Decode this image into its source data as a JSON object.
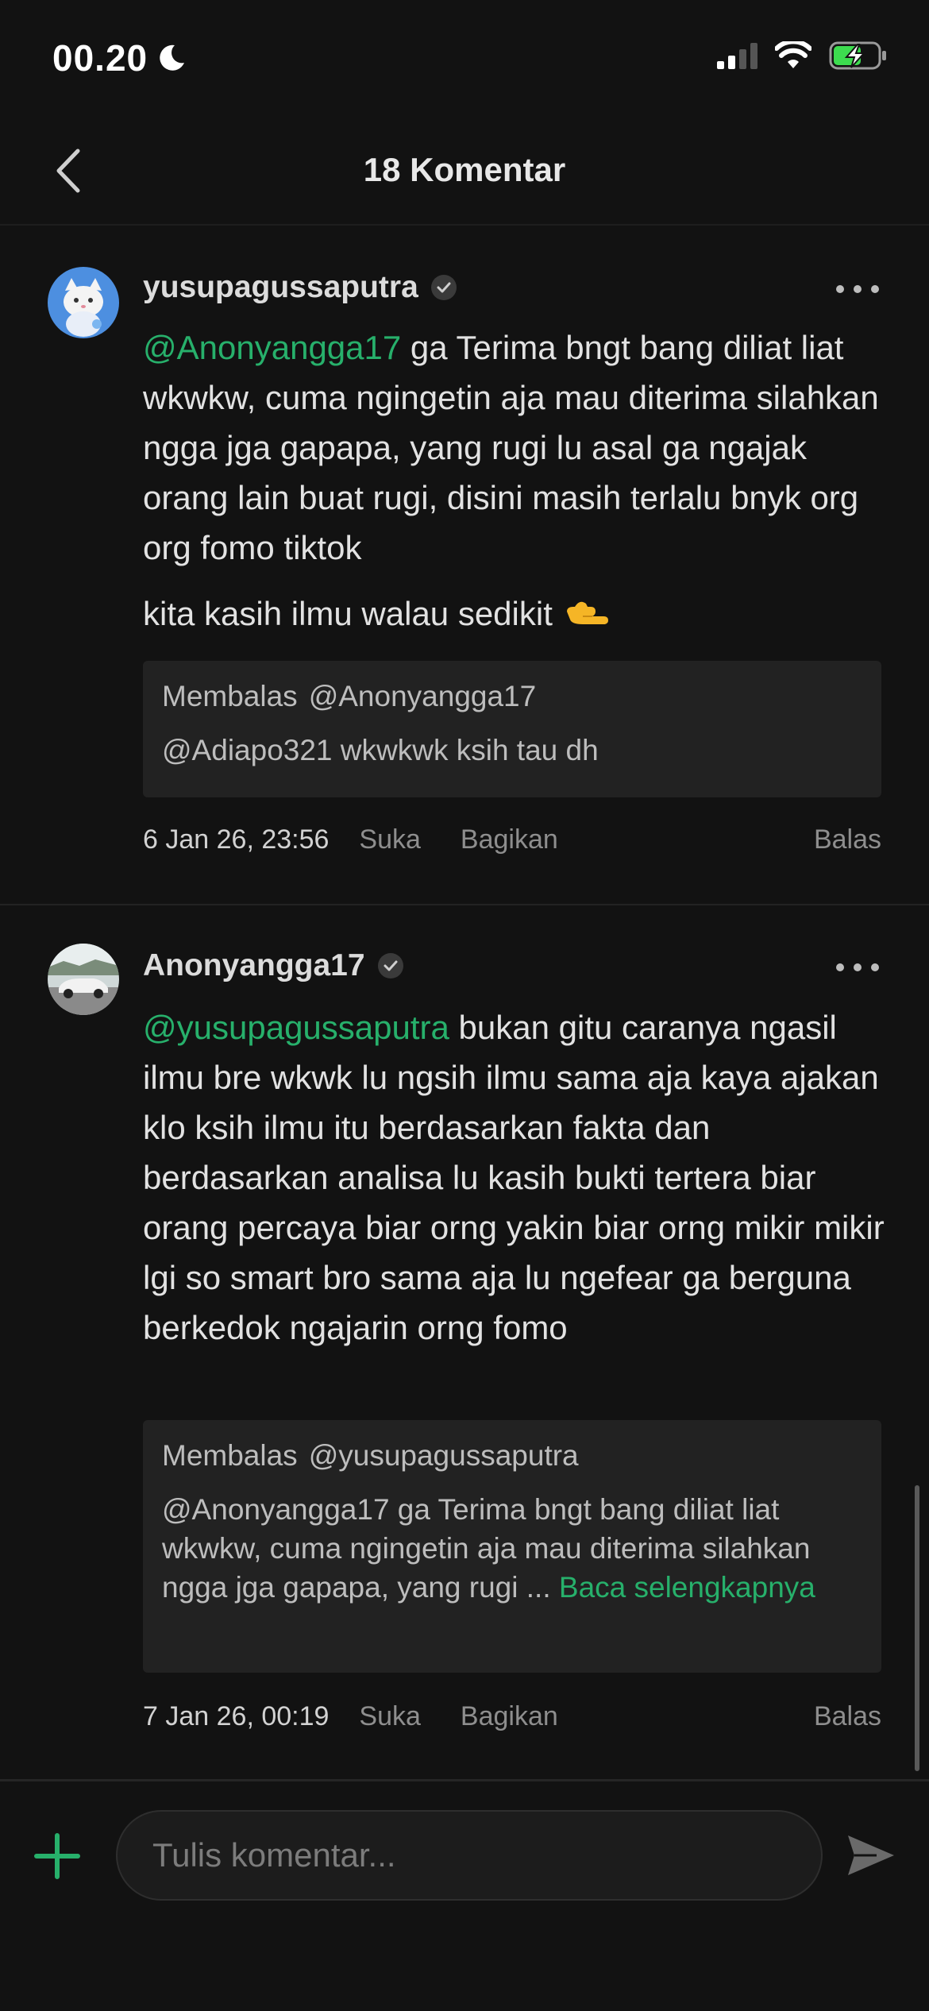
{
  "status_bar": {
    "time": "00.20",
    "icons": [
      "moon-icon",
      "signal-icon",
      "wifi-icon",
      "battery-charging-icon"
    ],
    "battery_color": "#3ddc4f"
  },
  "header": {
    "title": "18 Komentar",
    "back_icon": "chevron-left-icon"
  },
  "colors": {
    "accent": "#27b06b",
    "background": "#121212",
    "reply_box": "#222222"
  },
  "comments": [
    {
      "username": "yusupagussaputra",
      "verified": true,
      "mention": "@Anonyangga17",
      "text": " ga Terima bngt bang diliat liat wkwkw, cuma ngingetin aja mau diterima silahkan ngga jga gapapa, yang rugi lu asal ga ngajak orang lain buat rugi, disini masih terlalu bnyk org org fomo tiktok",
      "extra_line": "kita kasih ilmu walau sedikit",
      "extra_emoji": "pointing-hand-emoji",
      "reply_to": {
        "label": "Membalas",
        "user": "@Anonyangga17",
        "text": "@Adiapo321 wkwkwk ksih tau dh"
      },
      "date": "6 Jan 26, 23:56",
      "like_label": "Suka",
      "share_label": "Bagikan",
      "reply_label": "Balas"
    },
    {
      "username": "Anonyangga17",
      "verified": true,
      "mention": "@yusupagussaputra",
      "text": " bukan gitu caranya ngasil ilmu bre wkwk lu ngsih ilmu sama aja kaya ajakan klo ksih ilmu itu berdasarkan fakta dan berdasarkan analisa lu kasih bukti tertera biar orang percaya biar orng yakin biar orng mikir mikir lgi so smart bro sama aja lu ngefear ga berguna berkedok ngajarin orng fomo",
      "reply_to": {
        "label": "Membalas",
        "user": "@yusupagussaputra",
        "text": "@Anonyangga17 ga Terima bngt bang diliat liat wkwkw, cuma ngingetin aja mau diterima silahkan ngga jga gapapa, yang rugi ...",
        "read_more": "Baca selengkapnya"
      },
      "date": "7 Jan 26, 00:19",
      "like_label": "Suka",
      "share_label": "Bagikan",
      "reply_label": "Balas"
    }
  ],
  "composer": {
    "placeholder": "Tulis komentar...",
    "plus_icon": "plus-icon",
    "send_icon": "send-icon"
  }
}
